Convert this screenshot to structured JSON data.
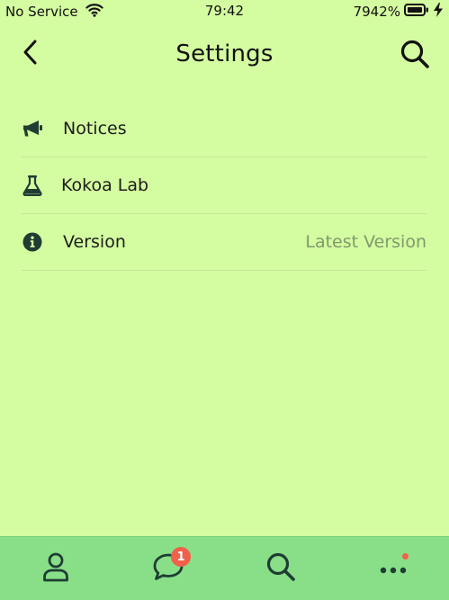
{
  "status_bar": {
    "carrier": "No Service",
    "time": "79:42",
    "battery_percent": "7942%",
    "icons": [
      "wifi-icon",
      "battery-icon",
      "charging-bolt-icon"
    ]
  },
  "header": {
    "title": "Settings",
    "back_icon": "chevron-left-icon",
    "search_icon": "search-icon"
  },
  "settings": {
    "items": [
      {
        "icon": "megaphone-icon",
        "label": "Notices"
      },
      {
        "icon": "flask-icon",
        "label": "Kokoa Lab"
      },
      {
        "icon": "info-icon",
        "label": "Version",
        "value": "Latest Version"
      }
    ]
  },
  "tabbar": {
    "tabs": [
      {
        "icon": "person-icon"
      },
      {
        "icon": "chat-bubble-icon",
        "badge": "1"
      },
      {
        "icon": "search-icon"
      },
      {
        "icon": "more-icon",
        "has_dot": true
      }
    ]
  },
  "colors": {
    "background": "#d4fca0",
    "tabbar": "#88df88",
    "icon": "#1f3d33",
    "badge": "#f0604a",
    "muted_text": "#7f9a6d"
  }
}
